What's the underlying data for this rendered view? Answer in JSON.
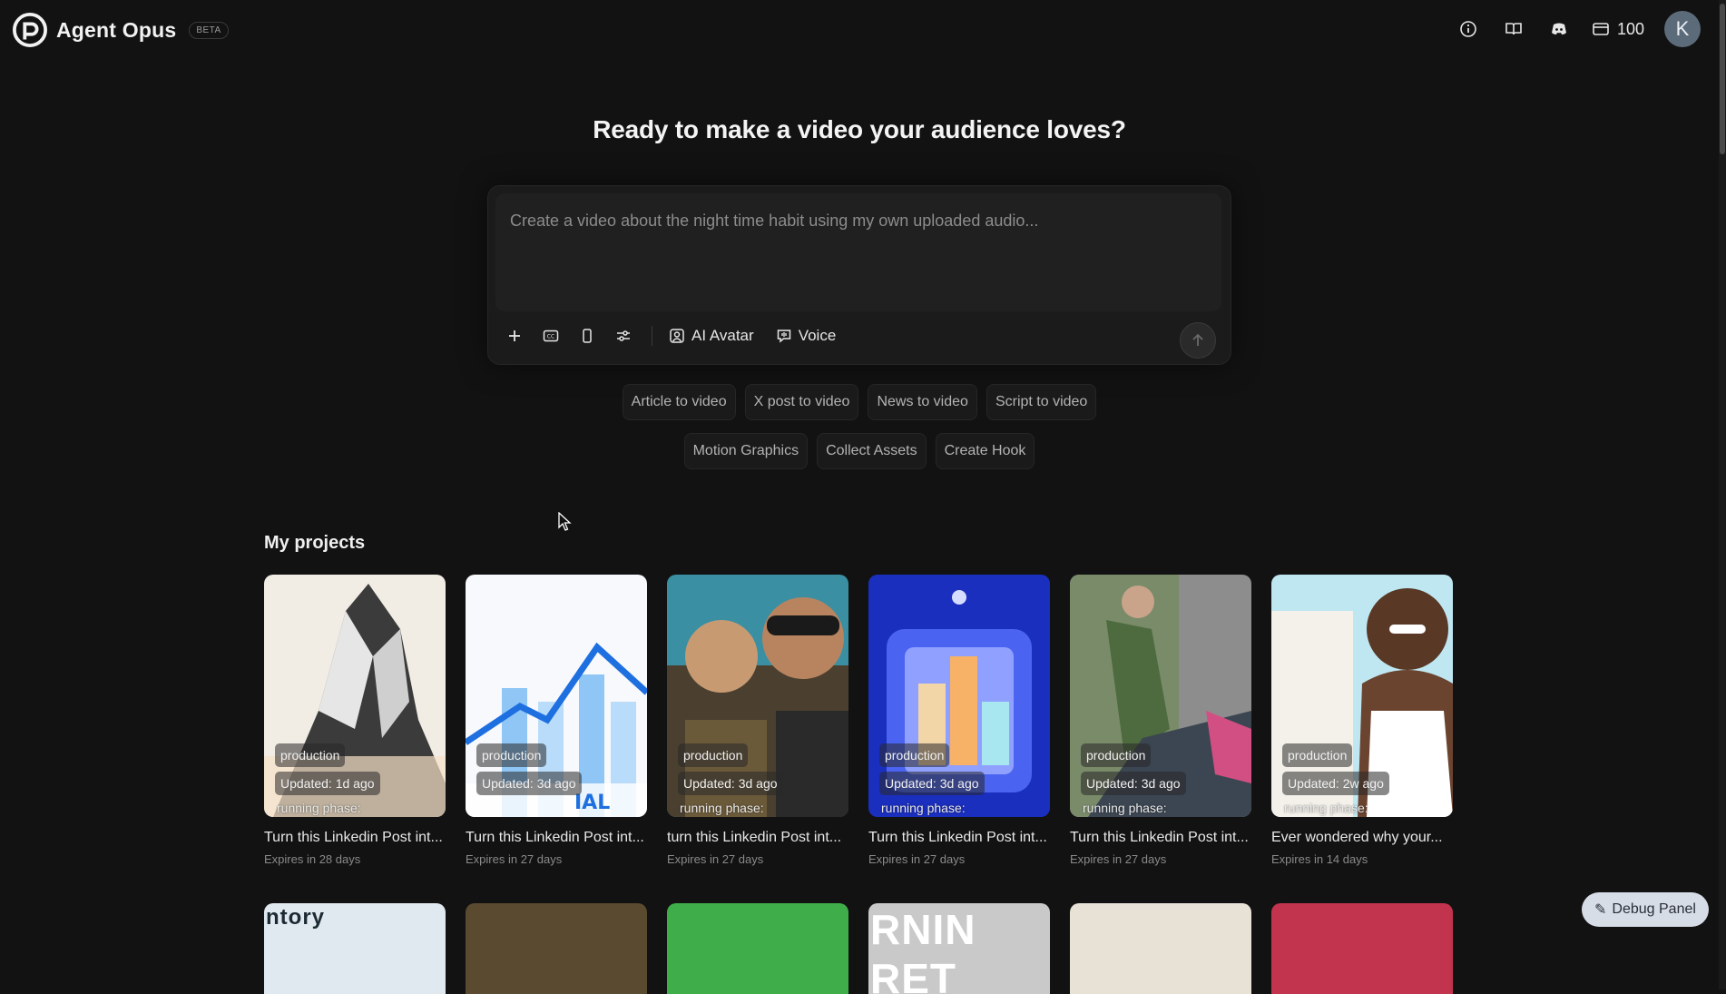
{
  "app": {
    "name": "Agent Opus",
    "badge": "BETA",
    "credits": "100",
    "avatar_initial": "K"
  },
  "topbar_icons": [
    "info-icon",
    "book-icon",
    "discord-icon",
    "credits-card-icon"
  ],
  "hero": {
    "title": "Ready to make a video your audience loves?"
  },
  "prompt": {
    "placeholder": "Create a video about the night time habit using my own uploaded audio...",
    "value": "",
    "tools": [
      "plus-icon",
      "captions-icon",
      "portrait-icon",
      "settings-sliders-icon"
    ],
    "ai_avatar_label": "AI Avatar",
    "voice_label": "Voice"
  },
  "chips_row1": [
    "Article to video",
    "X post to video",
    "News to video",
    "Script to video"
  ],
  "chips_row2": [
    "Motion Graphics",
    "Collect Assets",
    "Create Hook"
  ],
  "projects": {
    "title": "My projects",
    "items": [
      {
        "title": "Turn this Linkedin Post int...",
        "expires": "Expires in 28 days",
        "status": "production",
        "updated": "Updated: 1d ago",
        "phase": "running phase:"
      },
      {
        "title": "Turn this Linkedin Post int...",
        "expires": "Expires in 27 days",
        "status": "production",
        "updated": "Updated: 3d ago",
        "phase": ""
      },
      {
        "title": "turn this Linkedin Post int...",
        "expires": "Expires in 27 days",
        "status": "production",
        "updated": "Updated: 3d ago",
        "phase": "running phase:"
      },
      {
        "title": "Turn this Linkedin Post int...",
        "expires": "Expires in 27 days",
        "status": "production",
        "updated": "Updated: 3d ago",
        "phase": "running phase:"
      },
      {
        "title": "Turn this Linkedin Post int...",
        "expires": "Expires in 27 days",
        "status": "production",
        "updated": "Updated: 3d ago",
        "phase": "running phase:"
      },
      {
        "title": "Ever wondered why your...",
        "expires": "Expires in 14 days",
        "status": "production",
        "updated": "Updated: 2w ago",
        "phase": "running phase:"
      }
    ],
    "second_row_text": [
      "ntory",
      "",
      "",
      "RNIN RET",
      "",
      ""
    ]
  },
  "debug": {
    "label": "Debug Panel"
  }
}
